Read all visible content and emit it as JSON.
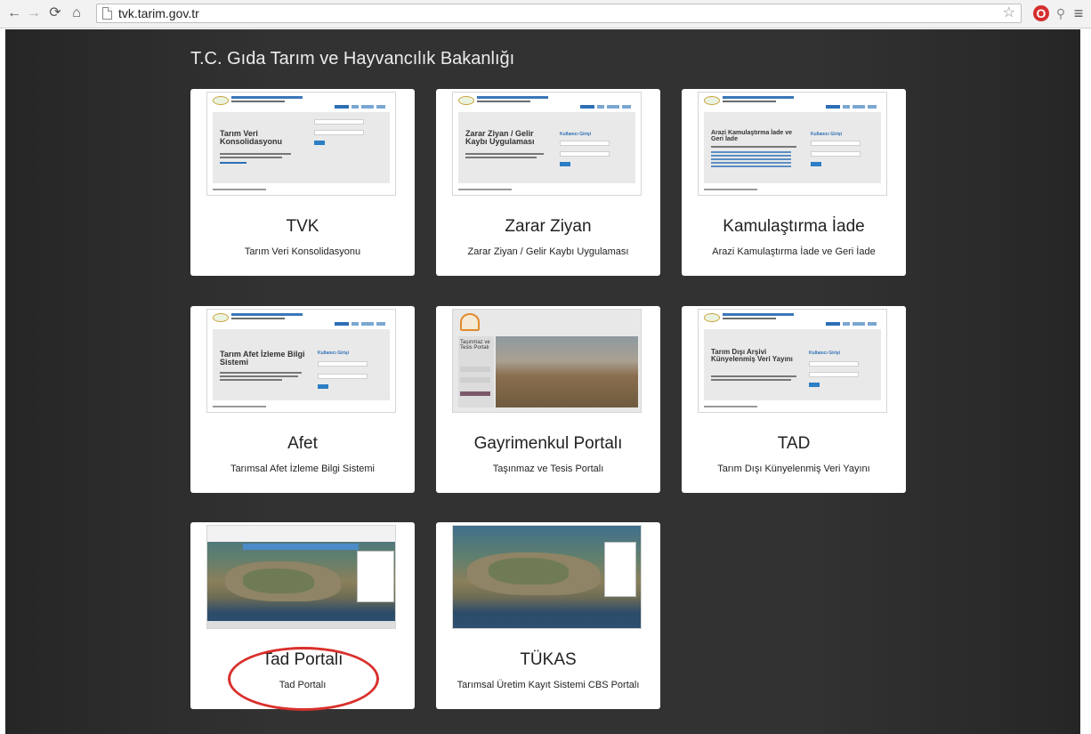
{
  "browser": {
    "url": "tvk.tarim.gov.tr"
  },
  "page": {
    "title": "T.C. Gıda Tarım ve Hayvancılık Bakanlığı"
  },
  "cards": [
    {
      "title": "TVK",
      "description": "Tarım Veri Konsolidasyonu",
      "thumb_heading": "Tarım Veri Konsolidasyonu"
    },
    {
      "title": "Zarar Ziyan",
      "description": "Zarar Ziyan / Gelir Kaybı Uygulaması",
      "thumb_heading": "Zarar Ziyan / Gelir Kaybı Uygulaması",
      "thumb_login": "Kullanıcı Girişi"
    },
    {
      "title": "Kamulaştırma İade",
      "description": "Arazi Kamulaştırma İade ve Geri İade",
      "thumb_heading": "Arazi Kamulaştırma İade ve Geri İade",
      "thumb_login": "Kullanıcı Girişi"
    },
    {
      "title": "Afet",
      "description": "Tarımsal Afet İzleme Bilgi Sistemi",
      "thumb_heading": "Tarım Afet İzleme Bilgi Sistemi",
      "thumb_login": "Kullanıcı Girişi"
    },
    {
      "title": "Gayrimenkul Portalı",
      "description": "Taşınmaz ve Tesis Portalı",
      "thumb_heading": "Taşınmaz ve Tesis Portalı"
    },
    {
      "title": "TAD",
      "description": "Tarım Dışı Künyelenmiş Veri Yayını",
      "thumb_heading": "Tarım Dışı Arşivi Künyelenmiş Veri Yayını",
      "thumb_login": "Kullanıcı Girişi"
    },
    {
      "title": "Tad Portalı",
      "description": "Tad Portalı"
    },
    {
      "title": "TÜKAS",
      "description": "Tarımsal Üretim Kayıt Sistemi CBS Portalı"
    }
  ],
  "colors": {
    "page_background": "#2e2e2e",
    "card_background": "#ffffff",
    "annotation": "#d9302c",
    "link_blue": "#2c6fb5"
  }
}
